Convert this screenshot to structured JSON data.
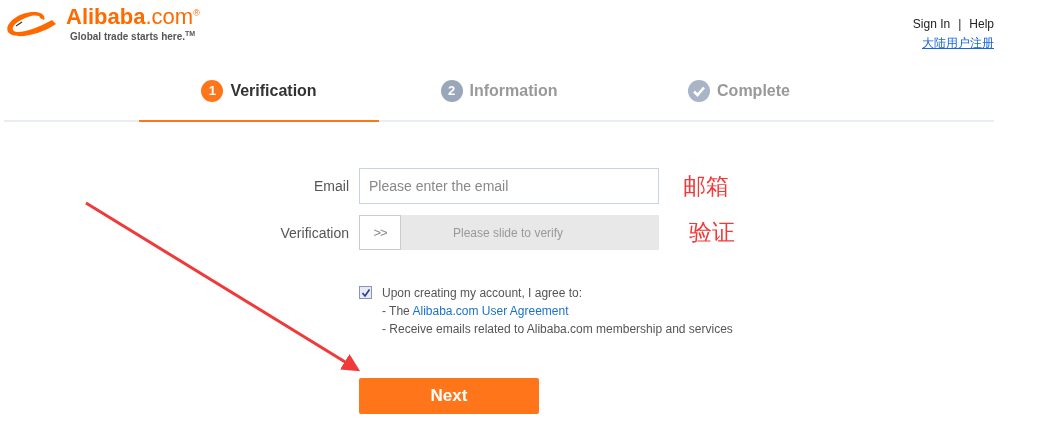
{
  "header": {
    "logo": {
      "name": "**Alibaba**.com$^{®}$",
      "tagline": "Global trade starts here.$^{TM}$"
    },
    "links": [
      {
        "label": "Sign In"
      },
      {
        "label": "Help"
      }
    ],
    "separator": "|",
    "register_link": "大陆用户注册"
  },
  "steps": [
    {
      "kind": "number",
      "badge": "1",
      "label": "Verification",
      "selected": true
    },
    {
      "kind": "number",
      "badge": "2",
      "label": "Information",
      "selected": false
    },
    {
      "kind": "check",
      "label": "Complete",
      "selected": false
    }
  ],
  "form": {
    "email": {
      "label": "Email",
      "placeholder": "Please enter the email",
      "annotation": "邮箱"
    },
    "verification": {
      "label": "Verification",
      "handle": ">>",
      "hint": "Please slide to verify",
      "annotation": "验证"
    },
    "agreement": {
      "checked": true,
      "intro": "Upon creating my account, I agree to:",
      "prefix": "- The ",
      "link": "Alibaba.com User Agreement",
      "consent": "- Receive emails related to Alibaba.com membership and services"
    },
    "button": "Next"
  }
}
